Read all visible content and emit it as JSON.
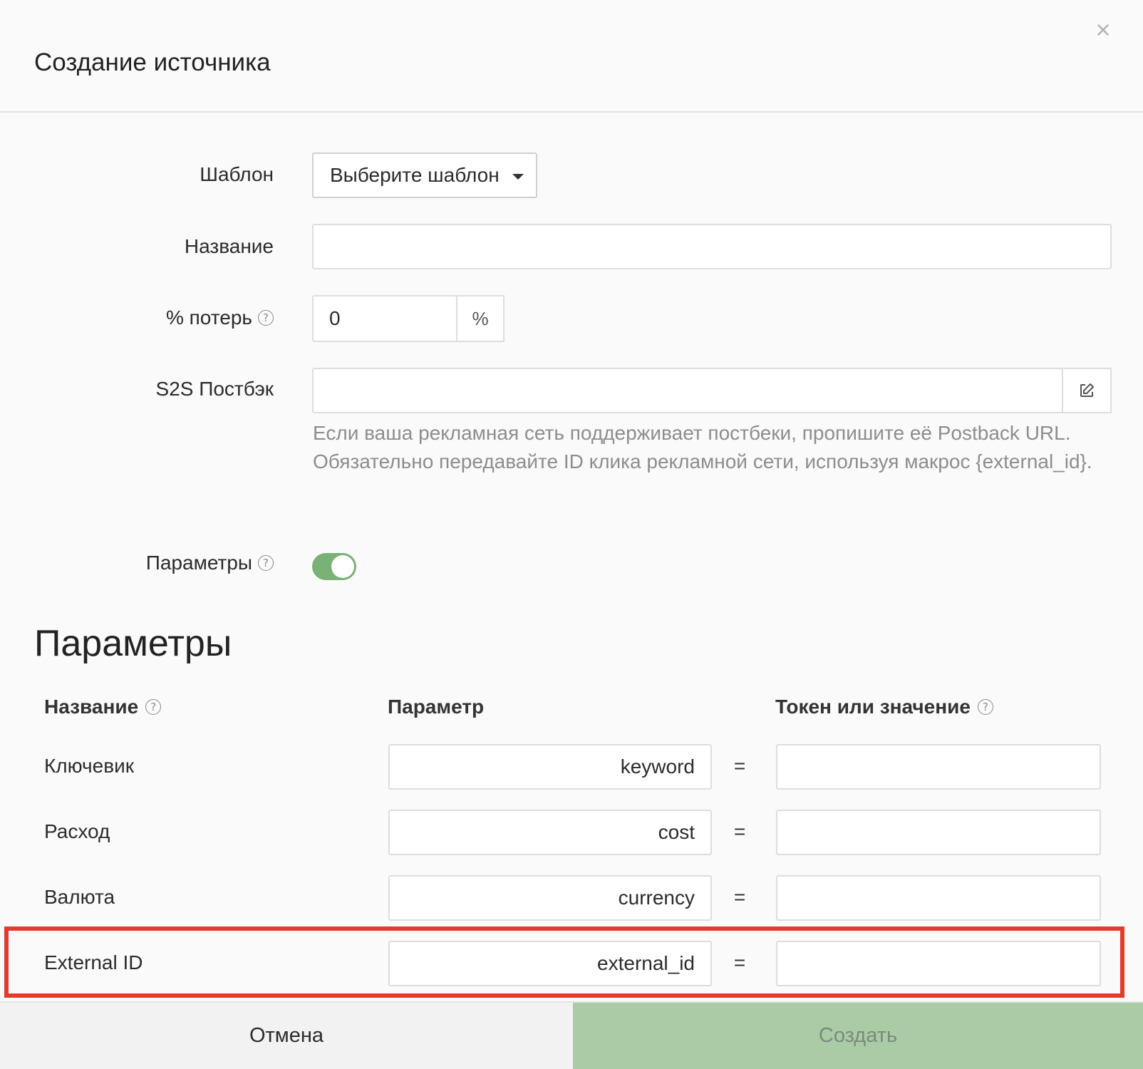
{
  "modal": {
    "title": "Создание источника",
    "close_glyph": "×"
  },
  "form": {
    "template": {
      "label": "Шаблон",
      "selected": "Выберите шаблон"
    },
    "name": {
      "label": "Название",
      "value": ""
    },
    "loss": {
      "label": "% потерь",
      "value": "0",
      "unit": "%"
    },
    "postback": {
      "label": "S2S Постбэк",
      "value": "",
      "hint": "Если ваша рекламная сеть поддерживает постбеки, пропишите её Postback URL. Обязательно передавайте ID клика рекламной сети, используя макрос {external_id}."
    },
    "params_toggle": {
      "label": "Параметры",
      "enabled": true
    }
  },
  "params": {
    "title": "Параметры",
    "columns": {
      "name": "Название",
      "param": "Параметр",
      "token": "Токен или значение"
    },
    "equals": "=",
    "rows": [
      {
        "name": "Ключевик",
        "param": "keyword",
        "token": ""
      },
      {
        "name": "Расход",
        "param": "cost",
        "token": ""
      },
      {
        "name": "Валюта",
        "param": "currency",
        "token": ""
      },
      {
        "name": "External ID",
        "param": "external_id",
        "token": ""
      }
    ]
  },
  "footer": {
    "cancel": "Отмена",
    "create": "Создать"
  },
  "colors": {
    "accent_green": "#79b274",
    "create_button": "#a9cba6",
    "highlight_red": "#e53b2c"
  },
  "icons": {
    "close": "close-icon",
    "caret": "caret-down-icon",
    "help": "question-circle-icon",
    "edit": "edit-icon"
  }
}
